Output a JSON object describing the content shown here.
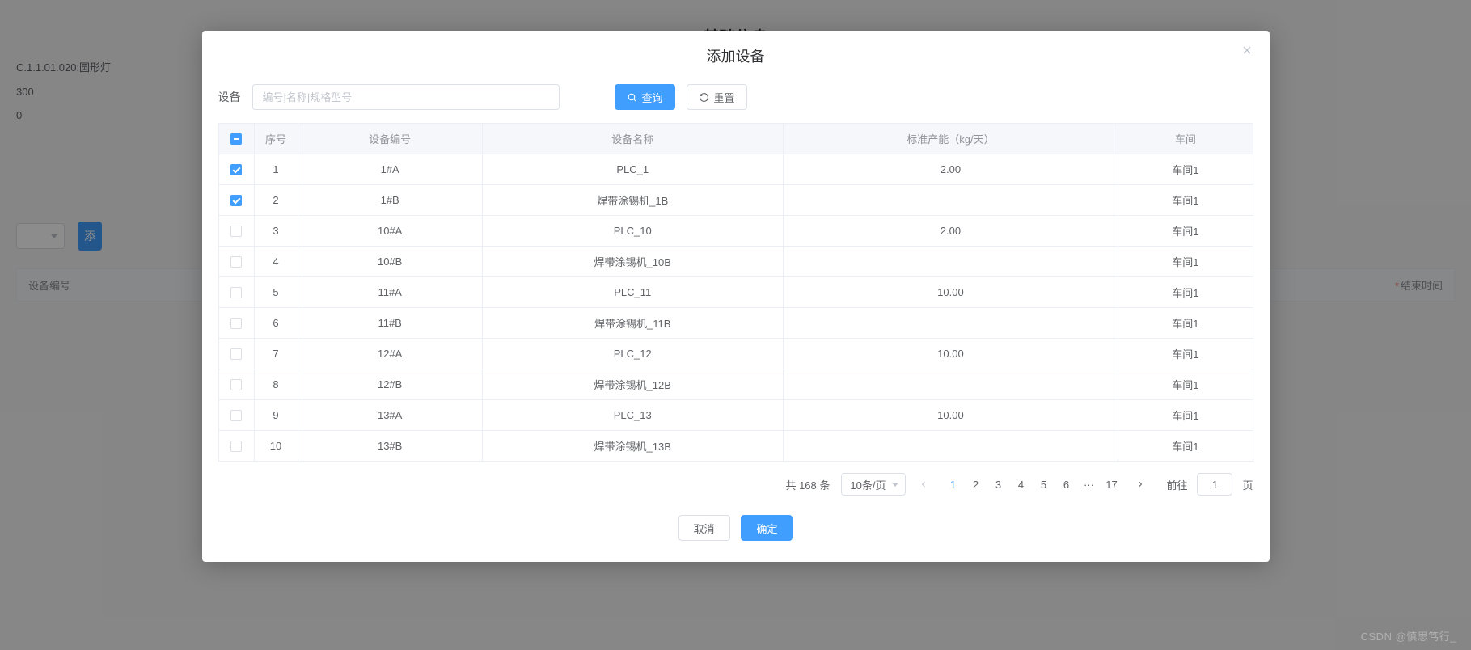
{
  "background": {
    "title": "基础信息",
    "line1": "C.1.1.01.020;圆形灯",
    "line2": "300",
    "line3": "0",
    "btn_blue": "添",
    "th_left": "设备编号",
    "th_right_req": "*",
    "th_right": "结束时间"
  },
  "modal": {
    "title": "添加设备",
    "search_label": "设备",
    "search_placeholder": "编号|名称|规格型号",
    "btn_query": "查询",
    "btn_reset": "重置",
    "table": {
      "headers": [
        "序号",
        "设备编号",
        "设备名称",
        "标准产能（kg/天）",
        "车间"
      ],
      "rows": [
        {
          "checked": true,
          "seq": "1",
          "code": "1#A",
          "name": "PLC_1",
          "cap": "2.00",
          "workshop": "车间1"
        },
        {
          "checked": true,
          "seq": "2",
          "code": "1#B",
          "name": "焊带涂锡机_1B",
          "cap": "",
          "workshop": "车间1"
        },
        {
          "checked": false,
          "seq": "3",
          "code": "10#A",
          "name": "PLC_10",
          "cap": "2.00",
          "workshop": "车间1"
        },
        {
          "checked": false,
          "seq": "4",
          "code": "10#B",
          "name": "焊带涂锡机_10B",
          "cap": "",
          "workshop": "车间1"
        },
        {
          "checked": false,
          "seq": "5",
          "code": "11#A",
          "name": "PLC_11",
          "cap": "10.00",
          "workshop": "车间1"
        },
        {
          "checked": false,
          "seq": "6",
          "code": "11#B",
          "name": "焊带涂锡机_11B",
          "cap": "",
          "workshop": "车间1"
        },
        {
          "checked": false,
          "seq": "7",
          "code": "12#A",
          "name": "PLC_12",
          "cap": "10.00",
          "workshop": "车间1"
        },
        {
          "checked": false,
          "seq": "8",
          "code": "12#B",
          "name": "焊带涂锡机_12B",
          "cap": "",
          "workshop": "车间1"
        },
        {
          "checked": false,
          "seq": "9",
          "code": "13#A",
          "name": "PLC_13",
          "cap": "10.00",
          "workshop": "车间1"
        },
        {
          "checked": false,
          "seq": "10",
          "code": "13#B",
          "name": "焊带涂锡机_13B",
          "cap": "",
          "workshop": "车间1"
        }
      ]
    },
    "pagination": {
      "total_text": "共 168 条",
      "page_size": "10条/页",
      "pages": [
        "1",
        "2",
        "3",
        "4",
        "5",
        "6",
        "···",
        "17"
      ],
      "current": "1",
      "jump_prefix": "前往",
      "jump_value": "1",
      "jump_suffix": "页",
      "prev_disabled": true,
      "next_disabled": false
    },
    "footer": {
      "cancel": "取消",
      "confirm": "确定"
    }
  },
  "watermark": "CSDN @慎思笃行_"
}
